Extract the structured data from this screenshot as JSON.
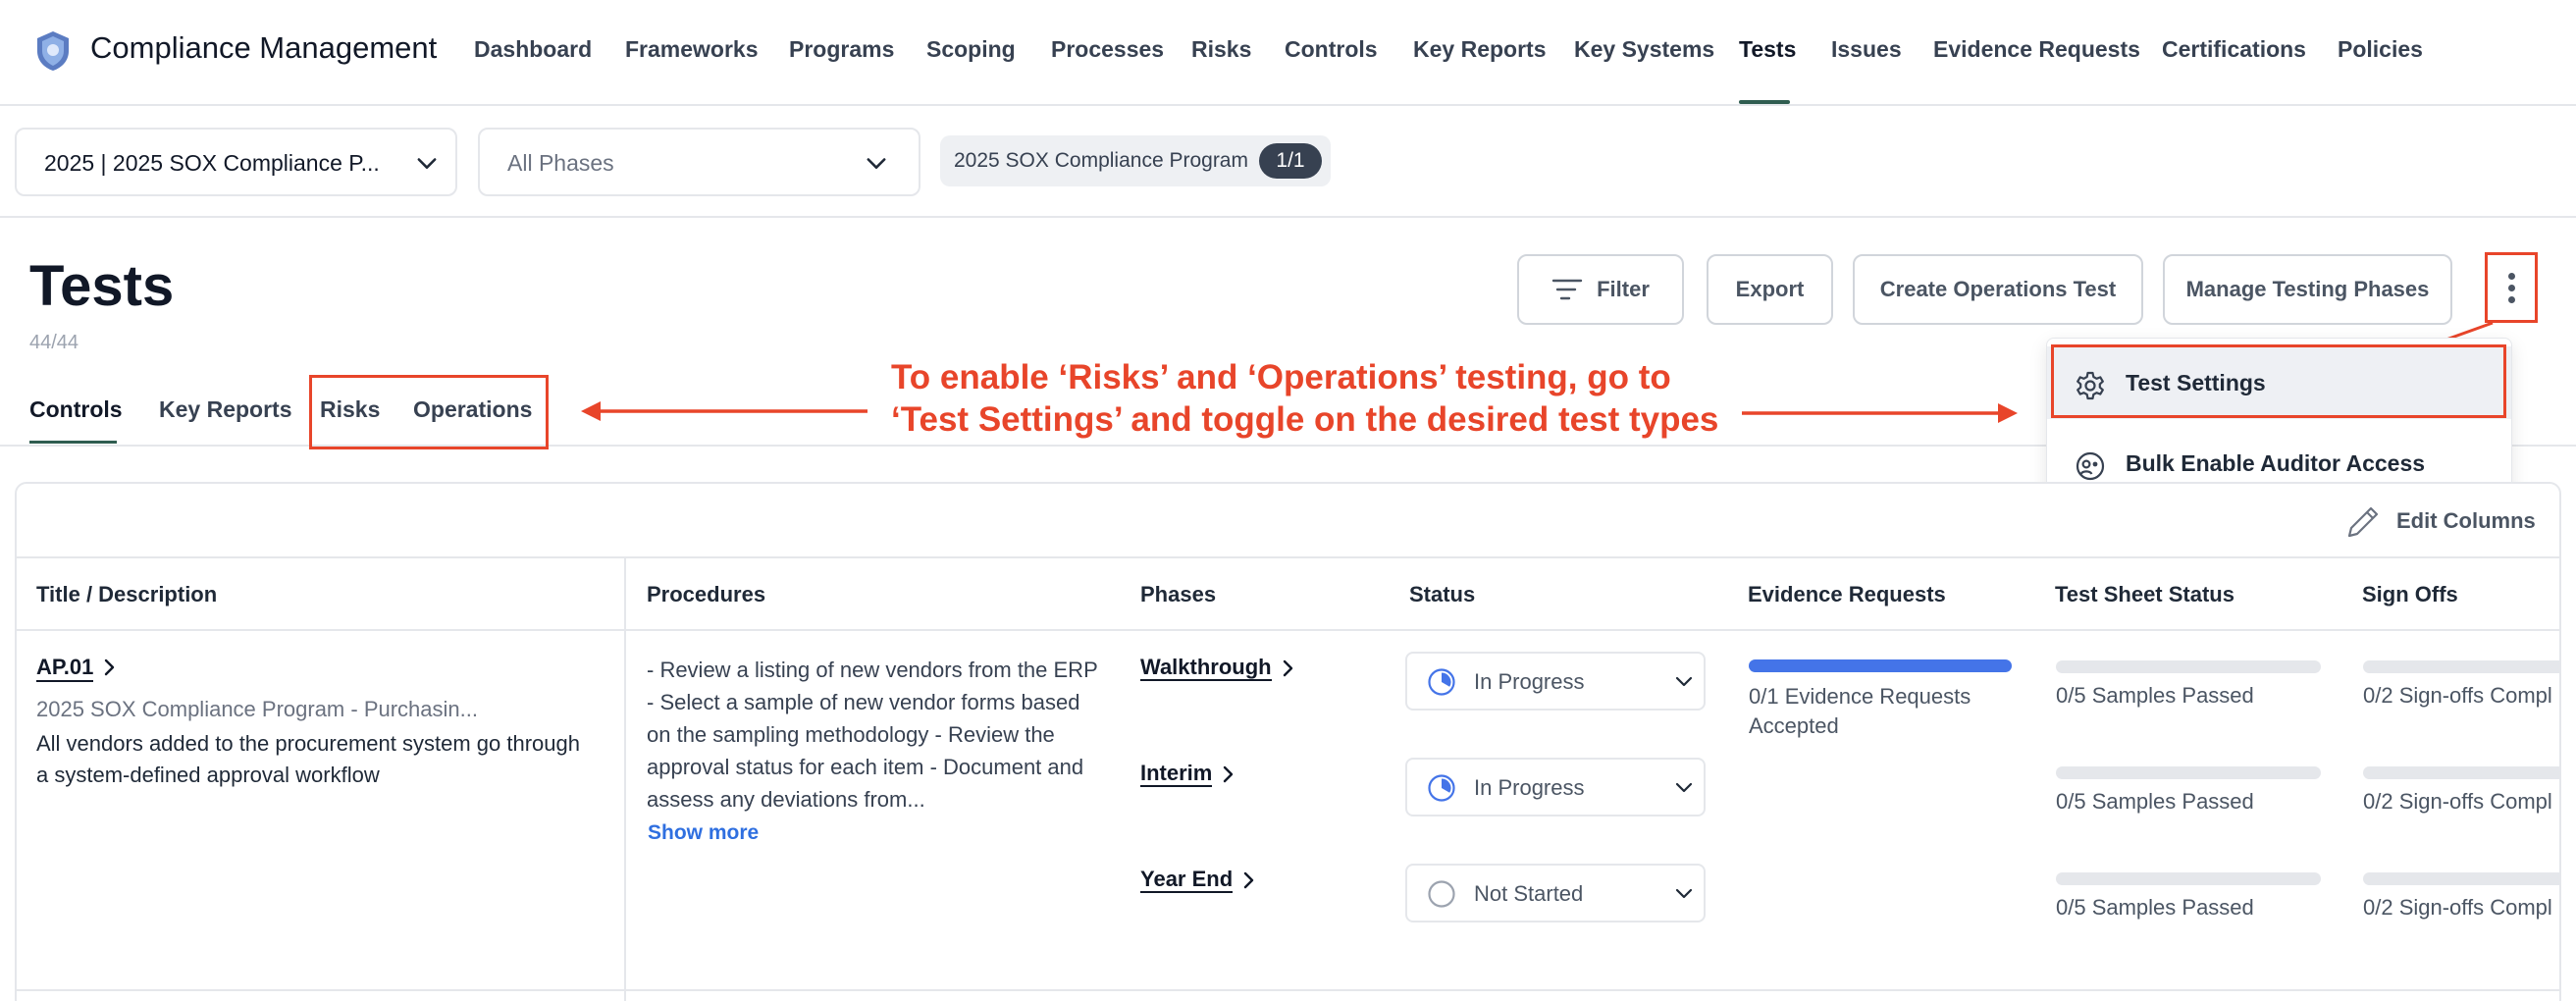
{
  "app": {
    "title": "Compliance Management"
  },
  "nav": [
    {
      "label": "Dashboard"
    },
    {
      "label": "Frameworks"
    },
    {
      "label": "Programs"
    },
    {
      "label": "Scoping"
    },
    {
      "label": "Processes"
    },
    {
      "label": "Risks"
    },
    {
      "label": "Controls"
    },
    {
      "label": "Key Reports"
    },
    {
      "label": "Key Systems"
    },
    {
      "label": "Tests",
      "active": true
    },
    {
      "label": "Issues"
    },
    {
      "label": "Evidence Requests"
    },
    {
      "label": "Certifications"
    },
    {
      "label": "Policies"
    }
  ],
  "filters": {
    "program_select": "2025 | 2025 SOX Compliance P...",
    "phase_select": "All Phases",
    "chip": {
      "label": "2025 SOX Compliance Program",
      "count": "1/1"
    }
  },
  "page": {
    "title": "Tests",
    "count": "44/44",
    "buttons": {
      "filter": "Filter",
      "export": "Export",
      "create": "Create Operations Test",
      "manage": "Manage Testing Phases"
    }
  },
  "tabs": [
    {
      "label": "Controls",
      "active": true
    },
    {
      "label": "Key Reports"
    },
    {
      "label": "Risks"
    },
    {
      "label": "Operations"
    }
  ],
  "annotation": {
    "line1": "To enable ‘Risks’ and ‘Operations’ testing, go to",
    "line2": "‘Test Settings’ and toggle on the desired test types",
    "color": "#e8452a"
  },
  "menu": {
    "test_settings": "Test Settings",
    "bulk_enable": "Bulk Enable Auditor Access"
  },
  "table": {
    "edit_columns": "Edit Columns",
    "headers": [
      "Title / Description",
      "Procedures",
      "Phases",
      "Status",
      "Evidence Requests",
      "Test Sheet Status",
      "Sign Offs"
    ],
    "row": {
      "id": "AP.01",
      "program": "2025 SOX Compliance Program - Purchasin...",
      "description": "All vendors added to the procurement system go through a system-defined approval workflow",
      "procedures": "- Review a listing of new vendors from the ERP - Select a sample of new vendor forms based on the sampling methodology - Review the approval status for each item - Document and assess any deviations from...",
      "show_more": "Show more",
      "phases": [
        {
          "name": "Walkthrough",
          "status": "In Progress",
          "test_sheet": "0/5 Samples Passed",
          "test_sheet_progress": 0,
          "sign_offs": "0/2 Sign-offs Compl",
          "sign_off_progress": 0
        },
        {
          "name": "Interim",
          "status": "In Progress",
          "test_sheet": "0/5 Samples Passed",
          "test_sheet_progress": 0,
          "sign_offs": "0/2 Sign-offs Compl",
          "sign_off_progress": 0
        },
        {
          "name": "Year End",
          "status": "Not Started",
          "test_sheet": "0/5 Samples Passed",
          "test_sheet_progress": 0,
          "sign_offs": "0/2 Sign-offs Compl",
          "sign_off_progress": 0
        }
      ],
      "evidence_requests": "0/1 Evidence Requests Accepted",
      "evidence_progress": 1
    }
  },
  "colors": {
    "accent": "#2f5d50",
    "highlight": "#e8452a",
    "progress": "#4474e8"
  }
}
